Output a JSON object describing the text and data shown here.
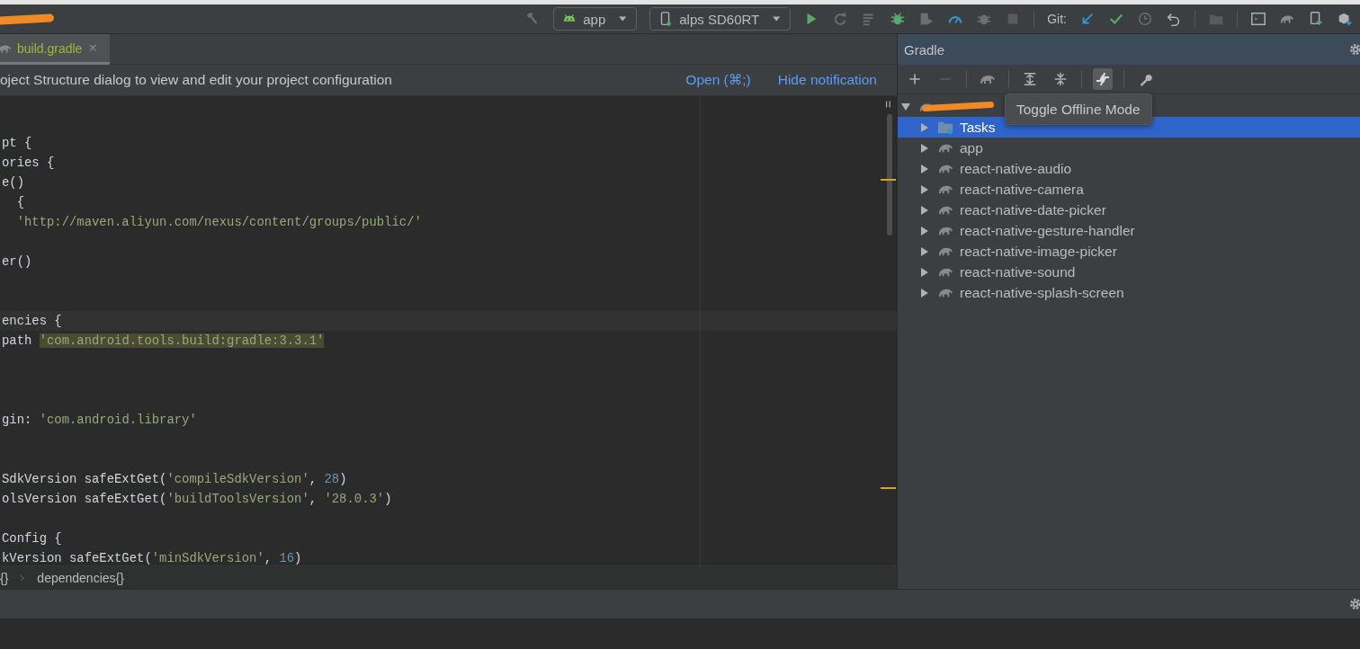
{
  "project": {
    "redacted": true
  },
  "toolbar": {
    "config": "app",
    "device": "alps SD60RT",
    "vcs_label": "Git:"
  },
  "editor": {
    "tabs": [
      {
        "label": "build.gradle",
        "selected": true,
        "modified": true
      }
    ],
    "notification": {
      "text": "oject Structure dialog to view and edit your project configuration",
      "links": [
        "Open (⌘;)",
        "Hide notification"
      ]
    },
    "lines": [
      {
        "current": false,
        "tokens": [
          {
            "kind": "plain",
            "text": "pt {"
          }
        ]
      },
      {
        "current": false,
        "tokens": [
          {
            "kind": "plain",
            "text": "ories {"
          }
        ]
      },
      {
        "current": false,
        "tokens": [
          {
            "kind": "plain",
            "text": "e()"
          }
        ]
      },
      {
        "current": false,
        "tokens": [
          {
            "kind": "plain",
            "text": "  {"
          }
        ]
      },
      {
        "current": false,
        "tokens": [
          {
            "kind": "string",
            "text": "  'http://maven.aliyun.com/nexus/content/groups/public/'"
          }
        ]
      },
      {
        "blank": true
      },
      {
        "current": false,
        "tokens": [
          {
            "kind": "plain",
            "text": "er()"
          }
        ]
      },
      {
        "blank": true
      },
      {
        "blank": true
      },
      {
        "current": true,
        "tokens": [
          {
            "kind": "plain",
            "text": "encies {"
          }
        ]
      },
      {
        "current": false,
        "tokens": [
          {
            "kind": "plain",
            "text": "path "
          },
          {
            "kind": "match",
            "text": "'com.android.tools.build:gradle:3.3.1'"
          }
        ]
      },
      {
        "blank": true
      },
      {
        "blank": true
      },
      {
        "blank": true
      },
      {
        "current": false,
        "tokens": [
          {
            "kind": "plain",
            "text": "gin: "
          },
          {
            "kind": "string",
            "text": "'com.android.library'"
          }
        ]
      },
      {
        "blank": true
      },
      {
        "blank": true
      },
      {
        "current": false,
        "tokens": [
          {
            "kind": "plain",
            "text": "SdkVersion safeExtGet("
          },
          {
            "kind": "string",
            "text": "'compileSdkVersion'"
          },
          {
            "kind": "plain",
            "text": ", "
          },
          {
            "kind": "number",
            "text": "28"
          },
          {
            "kind": "plain",
            "text": ")"
          }
        ]
      },
      {
        "current": false,
        "tokens": [
          {
            "kind": "plain",
            "text": "olsVersion safeExtGet("
          },
          {
            "kind": "string",
            "text": "'buildToolsVersion'"
          },
          {
            "kind": "plain",
            "text": ", "
          },
          {
            "kind": "string",
            "text": "'28.0.3'"
          },
          {
            "kind": "plain",
            "text": ")"
          }
        ]
      },
      {
        "blank": true
      },
      {
        "current": false,
        "tokens": [
          {
            "kind": "plain",
            "text": "Config {"
          }
        ]
      },
      {
        "current": false,
        "tokens": [
          {
            "kind": "plain",
            "text": "kVersion safeExtGet("
          },
          {
            "kind": "string",
            "text": "'minSdkVersion'"
          },
          {
            "kind": "plain",
            "text": ", "
          },
          {
            "kind": "number",
            "text": "16"
          },
          {
            "kind": "plain",
            "text": ")"
          }
        ]
      }
    ],
    "breadcrumbs": [
      "{}",
      "dependencies{}"
    ]
  },
  "gradle_panel": {
    "title": "Gradle",
    "offline_toggle": {
      "pressed": true,
      "tooltip": "Toggle Offline Mode"
    },
    "tree": {
      "expanded": true,
      "redacted": true,
      "children": [
        {
          "label": "Tasks",
          "kind": "folder",
          "expanded": false,
          "selected": true
        },
        {
          "label": "app",
          "kind": "module",
          "expanded": false,
          "selected": false
        },
        {
          "label": "react-native-audio",
          "kind": "module",
          "expanded": false,
          "selected": false
        },
        {
          "label": "react-native-camera",
          "kind": "module",
          "expanded": false,
          "selected": false
        },
        {
          "label": "react-native-date-picker",
          "kind": "module",
          "expanded": false,
          "selected": false
        },
        {
          "label": "react-native-gesture-handler",
          "kind": "module",
          "expanded": false,
          "selected": false
        },
        {
          "label": "react-native-image-picker",
          "kind": "module",
          "expanded": false,
          "selected": false
        },
        {
          "label": "react-native-sound",
          "kind": "module",
          "expanded": false,
          "selected": false
        },
        {
          "label": "react-native-splash-screen",
          "kind": "module",
          "expanded": false,
          "selected": false
        }
      ]
    }
  }
}
